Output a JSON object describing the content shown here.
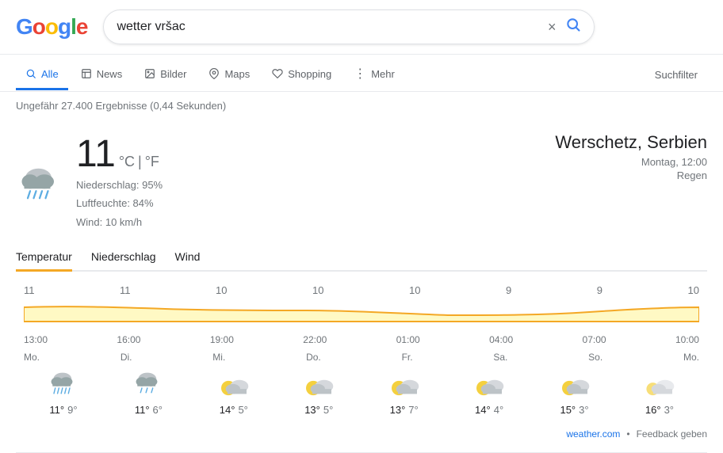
{
  "header": {
    "logo_letters": [
      "G",
      "o",
      "o",
      "g",
      "l",
      "e"
    ],
    "search_value": "wetter vršac",
    "clear_icon": "×",
    "search_icon": "🔍"
  },
  "nav": {
    "items": [
      {
        "id": "alle",
        "label": "Alle",
        "icon": "🔍",
        "active": true
      },
      {
        "id": "news",
        "label": "News",
        "icon": "📰",
        "active": false
      },
      {
        "id": "bilder",
        "label": "Bilder",
        "icon": "🖼",
        "active": false
      },
      {
        "id": "maps",
        "label": "Maps",
        "icon": "📍",
        "active": false
      },
      {
        "id": "shopping",
        "label": "Shopping",
        "icon": "🛍",
        "active": false
      },
      {
        "id": "mehr",
        "label": "Mehr",
        "icon": "⋮",
        "active": false
      }
    ],
    "suchfilter": "Suchfilter"
  },
  "results": {
    "count_text": "Ungefähr 27.400 Ergebnisse (0,44 Sekunden)"
  },
  "weather": {
    "temperature": "11",
    "unit_c": "°C",
    "unit_separator": "|",
    "unit_f": "°F",
    "details": {
      "precipitation": "Niederschlag: 95%",
      "humidity": "Luftfeuchte: 84%",
      "wind": "Wind: 10 km/h"
    },
    "city": "Werschetz, Serbien",
    "datetime": "Montag, 12:00",
    "condition": "Regen",
    "tabs": [
      "Temperatur",
      "Niederschlag",
      "Wind"
    ],
    "active_tab": "Temperatur",
    "chart_values": [
      "11",
      "11",
      "10",
      "10",
      "10",
      "9",
      "9",
      "10"
    ],
    "forecast": [
      {
        "time": "13:00",
        "day": "Mo.",
        "icon": "rain",
        "high": "11°",
        "low": "9°"
      },
      {
        "time": "16:00",
        "day": "Di.",
        "icon": "light-rain",
        "high": "11°",
        "low": "6°"
      },
      {
        "time": "19:00",
        "day": "Mi.",
        "icon": "partly-cloudy",
        "high": "14°",
        "low": "5°"
      },
      {
        "time": "22:00",
        "day": "Do.",
        "icon": "partly-cloudy",
        "high": "13°",
        "low": "5°"
      },
      {
        "time": "01:00",
        "day": "Fr.",
        "icon": "partly-cloudy",
        "high": "13°",
        "low": "7°"
      },
      {
        "time": "04:00",
        "day": "Sa.",
        "icon": "partly-cloudy",
        "high": "14°",
        "low": "4°"
      },
      {
        "time": "07:00",
        "day": "So.",
        "icon": "partly-cloudy",
        "high": "15°",
        "low": "3°"
      },
      {
        "time": "10:00",
        "day": "Mo.",
        "icon": "partly-cloudy-light",
        "high": "16°",
        "low": "3°"
      }
    ],
    "footer": {
      "source": "weather.com",
      "source_url": "#",
      "feedback": "Feedback geben",
      "dot": "•"
    }
  }
}
